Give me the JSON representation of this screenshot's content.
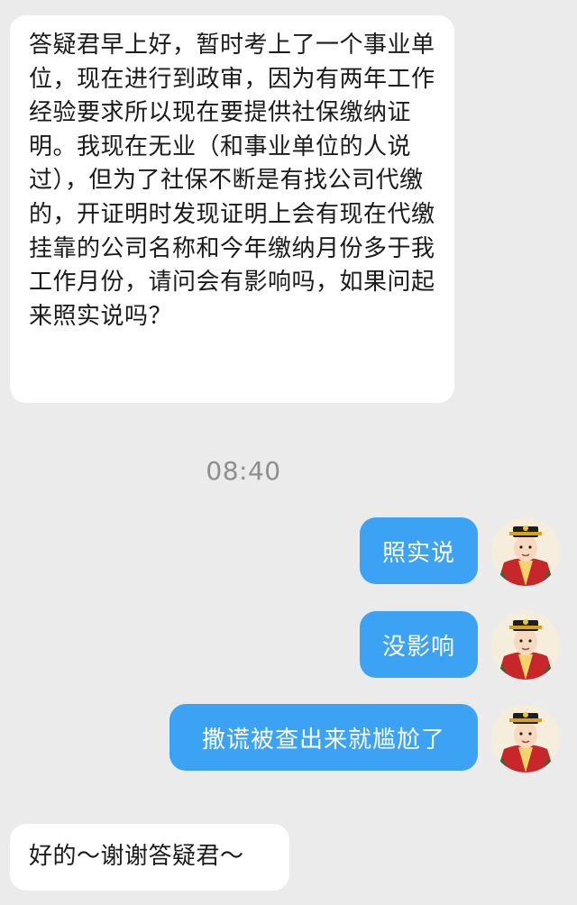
{
  "messages": [
    {
      "side": "incoming",
      "text": "答疑君早上好，暂时考上了一个事业单位，现在进行到政审，因为有两年工作经验要求所以现在要提供社保缴纳证明。我现在无业（和事业单位的人说过），但为了社保不断是有找公司代缴的，开证明时发现证明上会有现在代缴挂靠的公司名称和今年缴纳月份多于我工作月份，请问会有影响吗，如果问起来照实说吗？"
    },
    {
      "side": "timestamp",
      "text": "08:40"
    },
    {
      "side": "outgoing",
      "text": "照实说",
      "avatar_icon": "emperor-avatar-icon"
    },
    {
      "side": "outgoing",
      "text": "没影响",
      "avatar_icon": "emperor-avatar-icon"
    },
    {
      "side": "outgoing",
      "text": "撒谎被查出来就尴尬了",
      "avatar_icon": "emperor-avatar-icon"
    },
    {
      "side": "incoming",
      "text": "好的～谢谢答疑君～"
    }
  ],
  "colors": {
    "background": "#ebebeb",
    "incoming_bubble": "#ffffff",
    "outgoing_bubble": "#3ca2f4",
    "timestamp_text": "#8e8e8e"
  }
}
